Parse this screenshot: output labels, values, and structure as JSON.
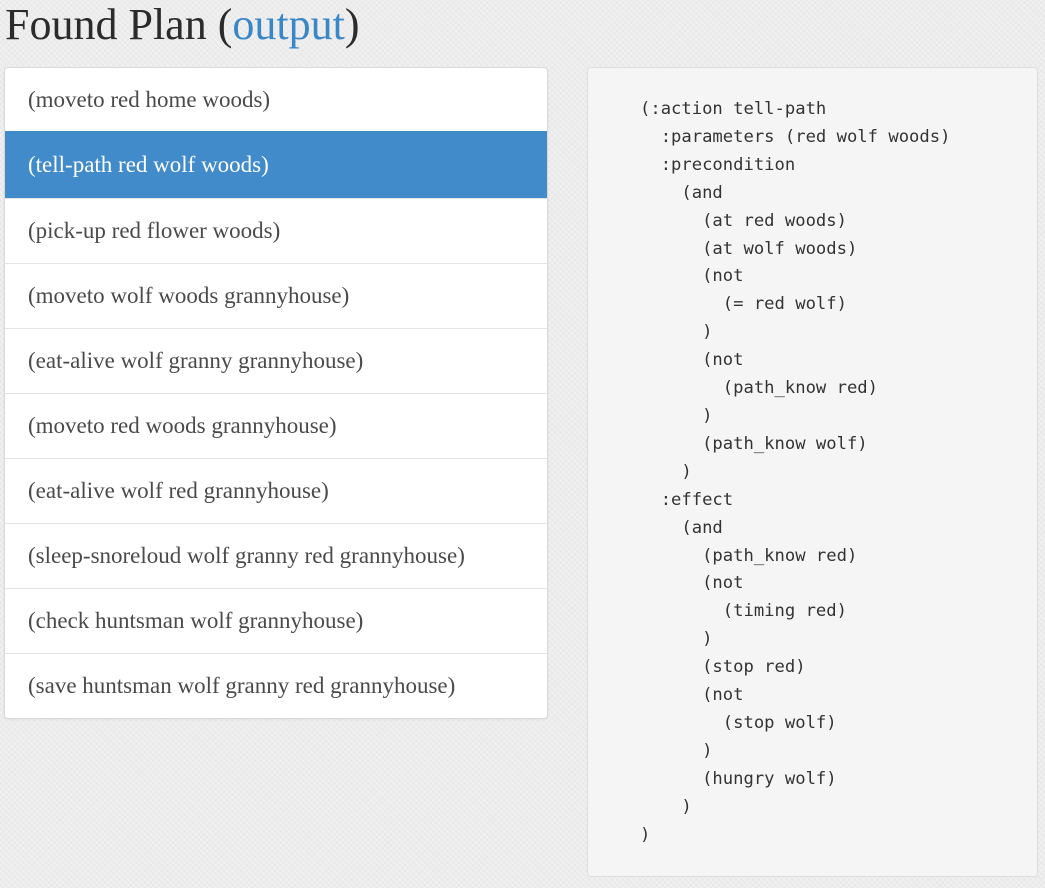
{
  "header": {
    "title": "Found Plan",
    "open_paren": "(",
    "link_label": "output",
    "close_paren": ")"
  },
  "plan": {
    "selected_index": 1,
    "steps": [
      "(moveto red home woods)",
      "(tell-path red wolf woods)",
      "(pick-up red flower woods)",
      "(moveto wolf woods grannyhouse)",
      "(eat-alive wolf granny grannyhouse)",
      "(moveto red woods grannyhouse)",
      "(eat-alive wolf red grannyhouse)",
      "(sleep-snoreloud wolf granny red grannyhouse)",
      "(check huntsman wolf grannyhouse)",
      "(save huntsman wolf granny red grannyhouse)"
    ]
  },
  "action_detail": {
    "code": "(:action tell-path\n  :parameters (red wolf woods)\n  :precondition\n    (and\n      (at red woods)\n      (at wolf woods)\n      (not\n        (= red wolf)\n      )\n      (not\n        (path_know red)\n      )\n      (path_know wolf)\n    )\n  :effect\n    (and\n      (path_know red)\n      (not\n        (timing red)\n      )\n      (stop red)\n      (not\n        (stop wolf)\n      )\n      (hungry wolf)\n    )\n)"
  },
  "colors": {
    "active_item_bg": "#428bca",
    "link": "#3a87c8",
    "panel_bg": "#f5f5f5"
  }
}
